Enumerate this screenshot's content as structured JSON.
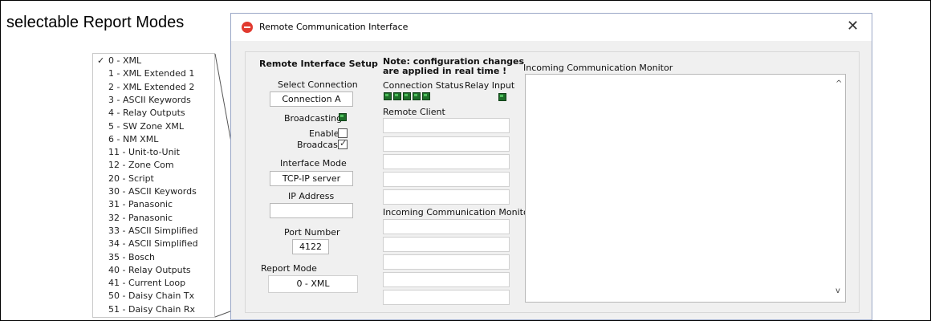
{
  "caption": "selectable Report Modes",
  "report_modes": {
    "checked_index": 0,
    "check_glyph": "✓",
    "items": [
      "0 - XML",
      "1 - XML Extended 1",
      "2 - XML Extended 2",
      "3 - ASCII Keywords",
      "4 - Relay Outputs",
      "5 - SW Zone XML",
      "6 - NM XML",
      "11 - Unit-to-Unit",
      "12 - Zone Com",
      "20 - Script",
      "30 - ASCII Keywords",
      "31 - Panasonic",
      "32 - Panasonic",
      "33 - ASCII Simplified",
      "34 - ASCII Simplified",
      "35 - Bosch",
      "40 - Relay Outputs",
      "41 - Current Loop",
      "50 - Daisy Chain Tx",
      "51 - Daisy Chain Rx"
    ]
  },
  "window": {
    "title": "Remote Communication Interface",
    "close_glyph": "✕",
    "logo_color": "#e13a2f"
  },
  "setup": {
    "heading": "Remote Interface Setup",
    "select_connection_label": "Select Connection",
    "select_connection_value": "Connection A",
    "broadcasting_label": "Broadcasting",
    "enable_broadcast_label_1": "Enable",
    "enable_broadcast_label_2": "Broadcast",
    "interface_mode_label": "Interface Mode",
    "interface_mode_value": "TCP-IP server",
    "ip_address_label": "IP Address",
    "ip_address_value": "",
    "port_number_label": "Port Number",
    "port_number_value": "4122",
    "report_mode_label": "Report Mode",
    "report_mode_value": "0 - XML"
  },
  "status": {
    "note_line1": "Note: configuration changes",
    "note_line2": "are applied in real time !",
    "connection_status_label": "Connection Status",
    "relay_input_label": "Relay Input",
    "remote_client_label": "Remote Client",
    "incoming_monitor_label": "Incoming Communication Monitor"
  },
  "monitor": {
    "label": "Incoming Communication Monitor",
    "scroll_up_glyph": "^",
    "scroll_down_glyph": "v"
  },
  "colors": {
    "led_green": "#1e6e2a",
    "dialog_bg": "#f0f0f0"
  }
}
